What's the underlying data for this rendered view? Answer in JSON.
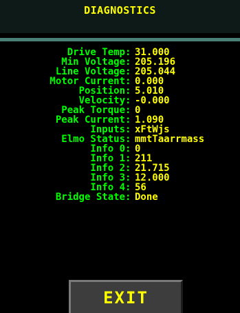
{
  "header": {
    "title": "DIAGNOSTICS"
  },
  "colors": {
    "background": "#000000",
    "header_bg": "#0e1a18",
    "divider": "#4a7f78",
    "label": "#00ff00",
    "value": "#ffff00",
    "button_bg": "#3d3d3d"
  },
  "diagnostics": {
    "separator": ":",
    "rows": [
      {
        "label": "Drive Temp",
        "value": "31.000"
      },
      {
        "label": "Min Voltage",
        "value": "205.196"
      },
      {
        "label": "Line Voltage",
        "value": "205.044"
      },
      {
        "label": "Motor Current",
        "value": "0.000"
      },
      {
        "label": "Position",
        "value": "5.010"
      },
      {
        "label": "Velocity",
        "value": "-0.000"
      },
      {
        "label": "Peak Torque",
        "value": "0"
      },
      {
        "label": "Peak Current",
        "value": "1.090"
      },
      {
        "label": "Inputs",
        "value": "xFtWjs"
      },
      {
        "label": "Elmo Status",
        "value": "mmtTaarrmass"
      },
      {
        "label": "Info 0",
        "value": "0"
      },
      {
        "label": "Info 1",
        "value": "211"
      },
      {
        "label": "Info 2",
        "value": "21.715"
      },
      {
        "label": "Info 3",
        "value": "12.000"
      },
      {
        "label": "Info 4",
        "value": "56"
      },
      {
        "label": "Bridge State",
        "value": "Done"
      }
    ]
  },
  "footer": {
    "exit_label": "EXIT"
  }
}
